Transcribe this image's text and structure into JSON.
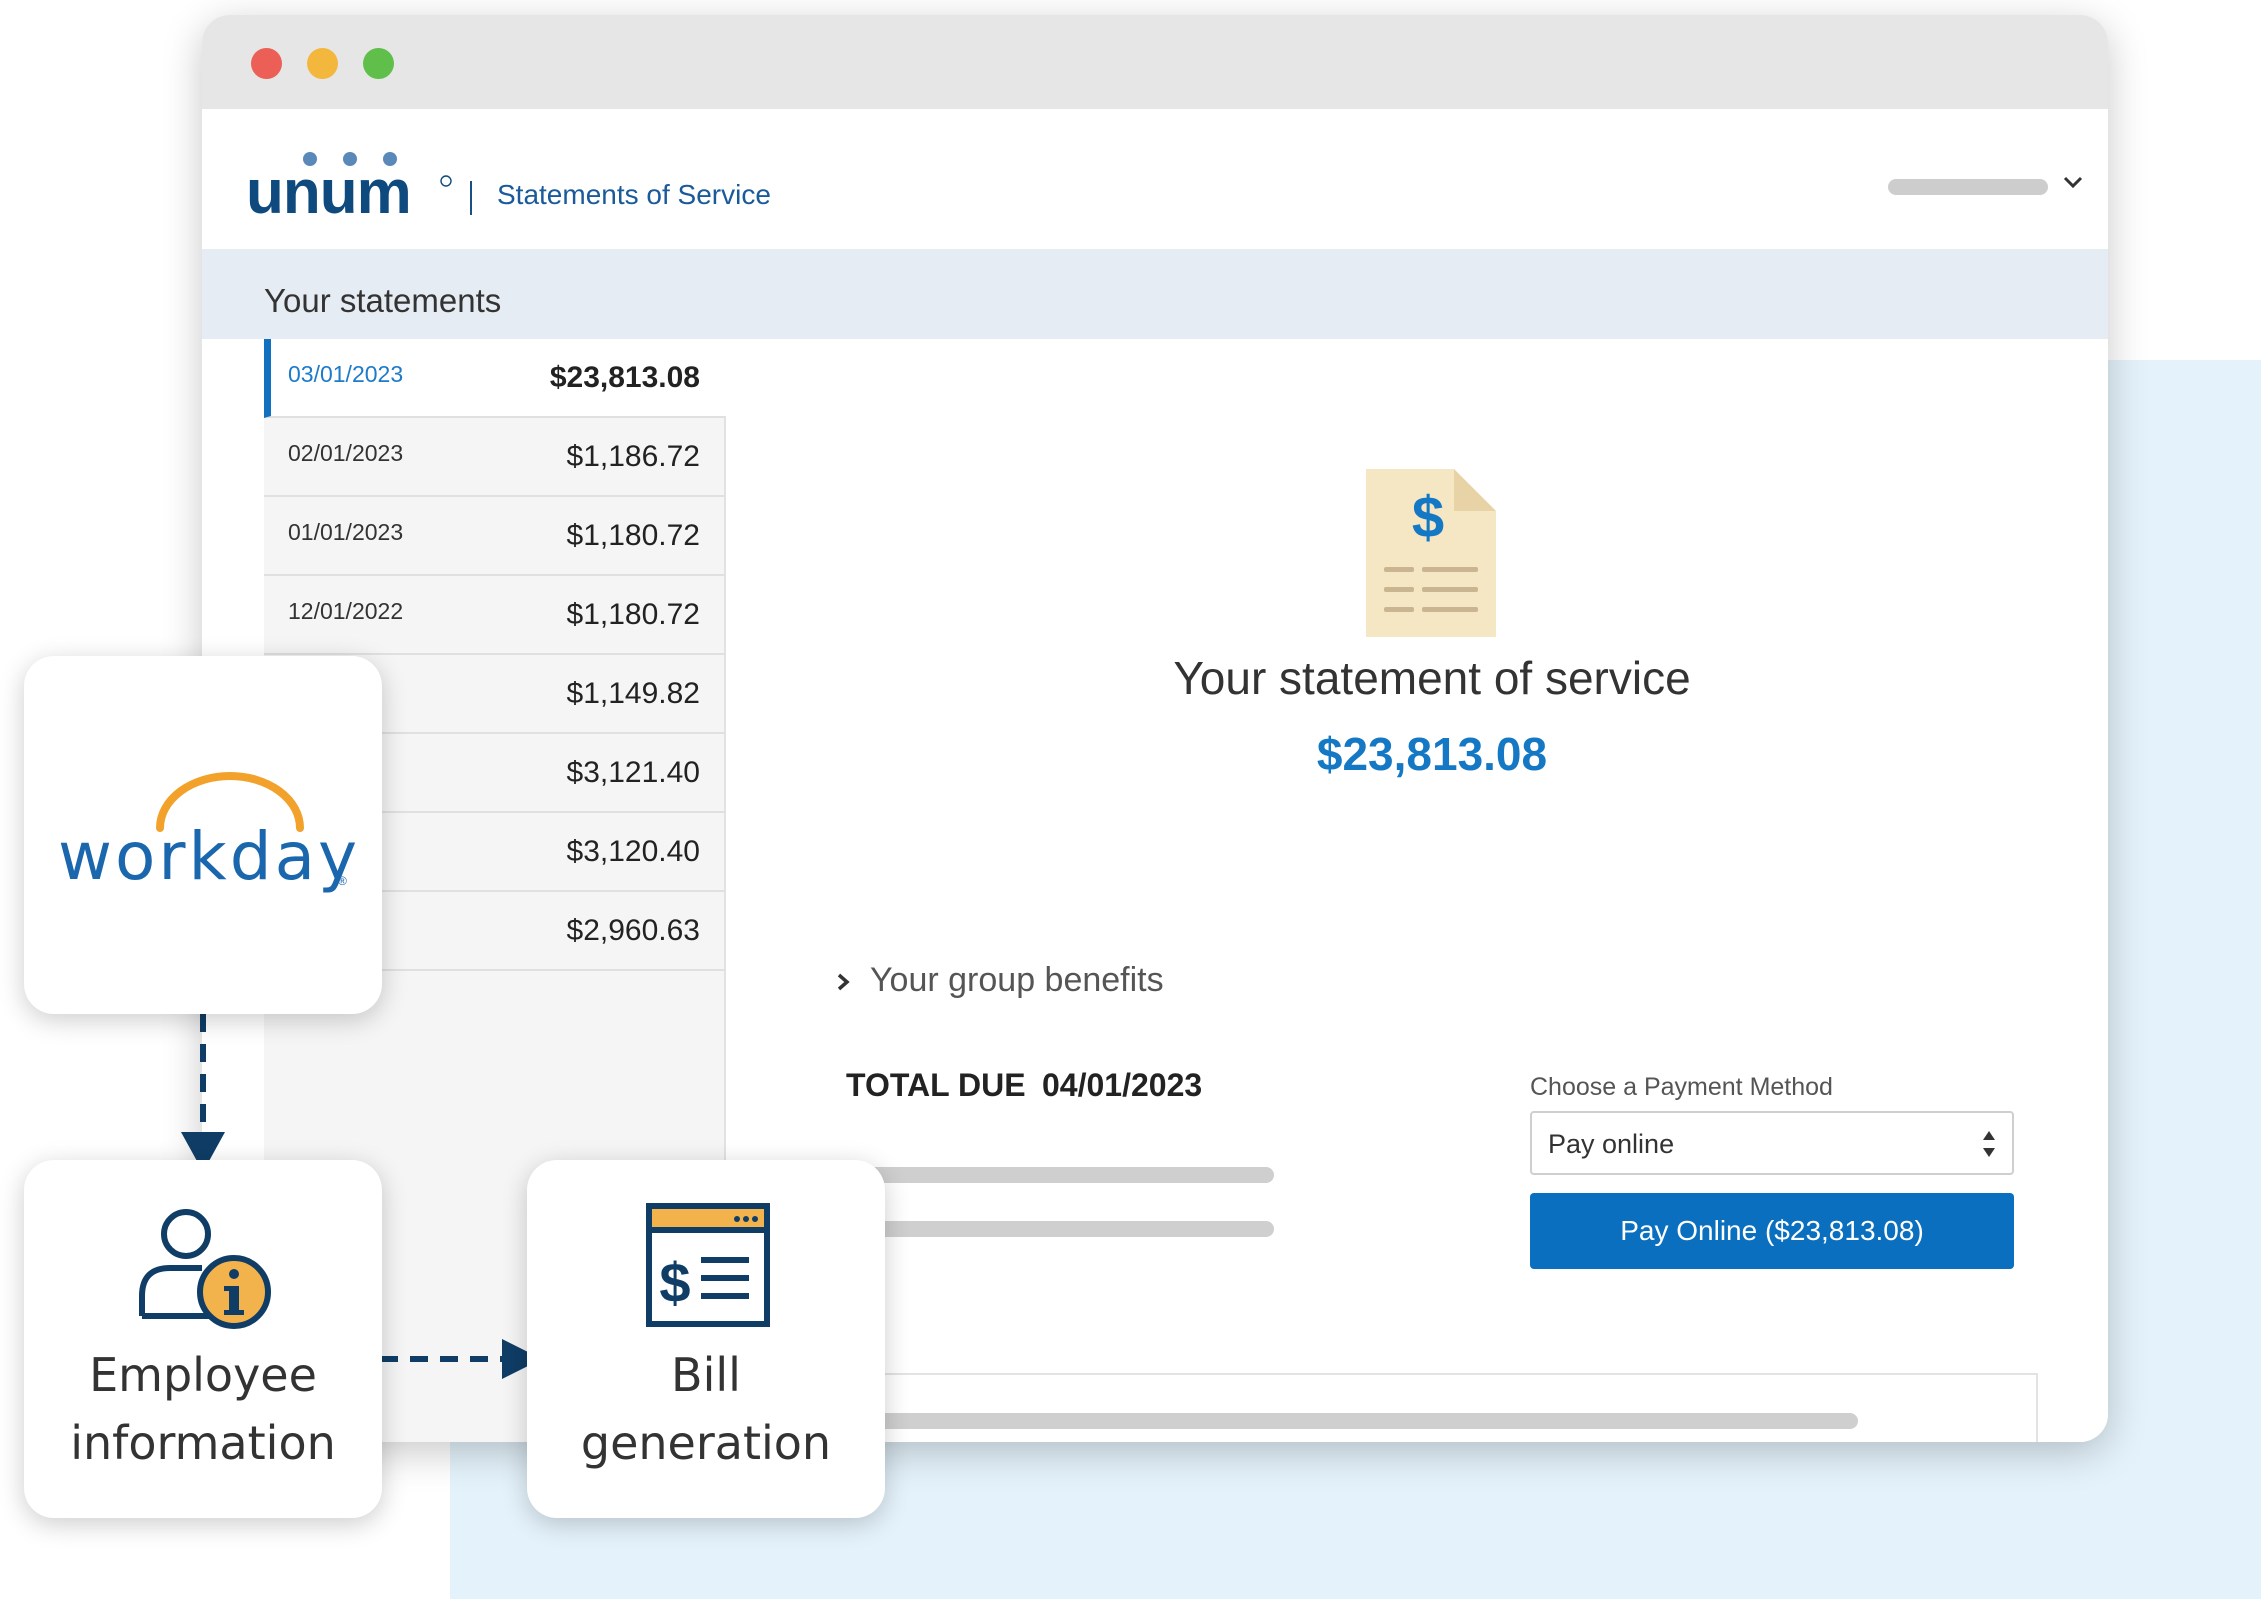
{
  "window": {
    "app_title": "Statements of Service",
    "user_menu_icon": "chevron-down-icon"
  },
  "statements": {
    "heading": "Your statements",
    "rows": [
      {
        "date": "03/01/2023",
        "amount": "$23,813.08",
        "active": true
      },
      {
        "date": "02/01/2023",
        "amount": "$1,186.72"
      },
      {
        "date": "01/01/2023",
        "amount": "$1,180.72"
      },
      {
        "date": "12/01/2022",
        "amount": "$1,180.72"
      },
      {
        "date": "22",
        "amount": "$1,149.82"
      },
      {
        "date": "22",
        "amount": "$3,121.40"
      },
      {
        "date": "22",
        "amount": "$3,120.40"
      },
      {
        "date": "22",
        "amount": "$2,960.63"
      }
    ]
  },
  "statement": {
    "title": "Your statement of service",
    "amount": "$23,813.08",
    "group_benefits": "Your group benefits",
    "total_due_label": "TOTAL DUE",
    "total_due_date": "04/01/2023"
  },
  "payment": {
    "label": "Choose a Payment Method",
    "selected": "Pay online",
    "button": "Pay Online ($23,813.08)"
  },
  "cards": {
    "workday": "workday",
    "employee_line1": "Employee",
    "employee_line2": "information",
    "bill_line1": "Bill",
    "bill_line2": "generation"
  },
  "colors": {
    "accent": "#0a6fbf",
    "brand_navy": "#0f4a7f",
    "workday_orange": "#f2a12a",
    "doc_tan": "#f5e6c4"
  }
}
